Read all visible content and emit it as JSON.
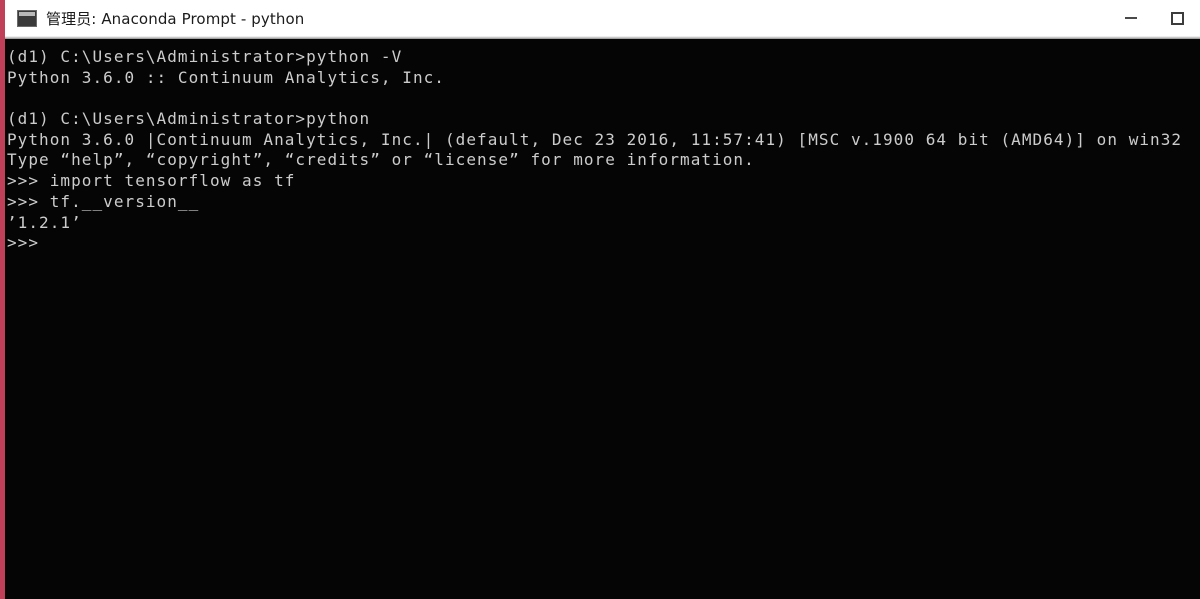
{
  "window": {
    "title": "管理员: Anaconda Prompt - python",
    "icon": "console-icon",
    "border_color": "#c0405a",
    "titlebar_background": "#ffffff",
    "console_background": "#050505",
    "console_text_color": "#cccccc"
  },
  "caption_buttons": [
    {
      "name": "minimize",
      "glyph": "—"
    },
    {
      "name": "maximize",
      "glyph": "▢"
    }
  ],
  "console": {
    "lines": [
      "(d1) C:\\Users\\Administrator>python -V",
      "Python 3.6.0 :: Continuum Analytics, Inc.",
      "",
      "(d1) C:\\Users\\Administrator>python",
      "Python 3.6.0 |Continuum Analytics, Inc.| (default, Dec 23 2016, 11:57:41) [MSC v.1900 64 bit (AMD64)] on win32",
      "Type “help”, “copyright”, “credits” or “license” for more information.",
      ">>> import tensorflow as tf",
      ">>> tf.__version__",
      "’1.2.1’",
      ">>>"
    ]
  }
}
